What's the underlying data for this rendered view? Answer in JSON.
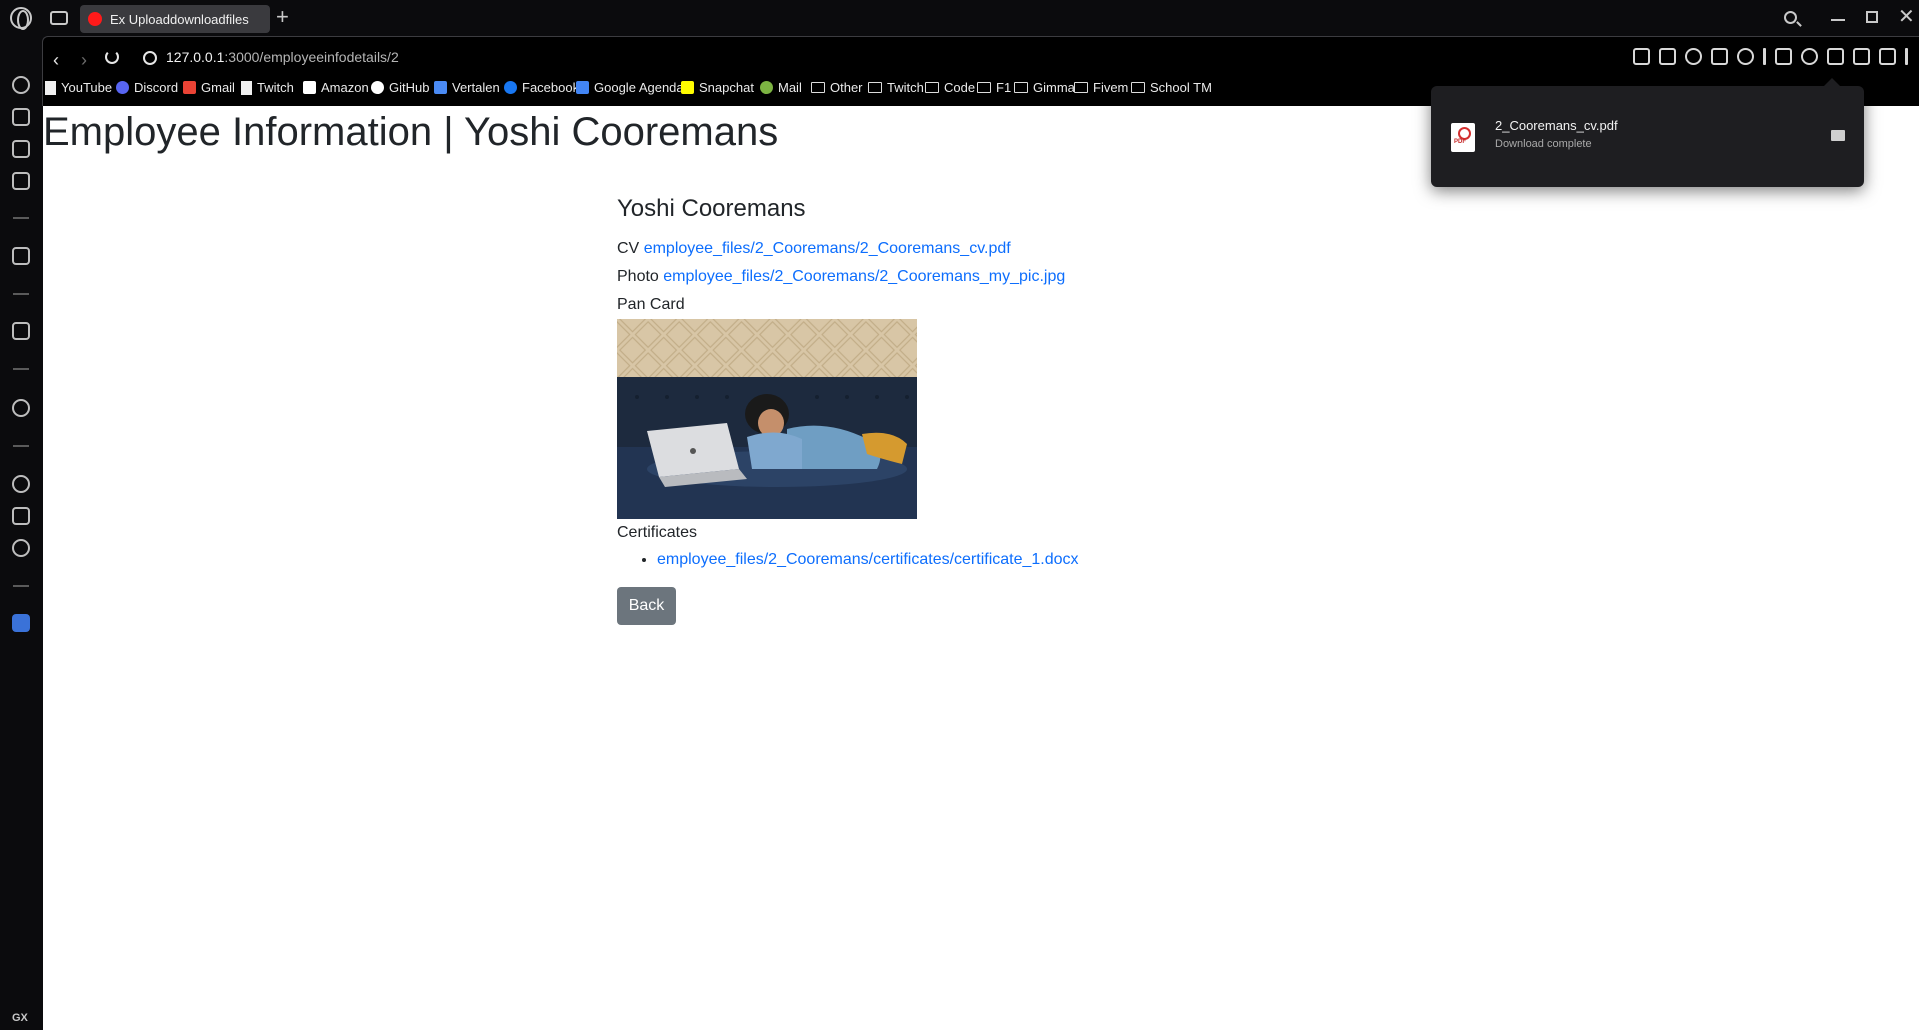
{
  "browser": {
    "tab_title": "Ex Uploaddownloadfiles",
    "new_tab": "+",
    "url_host": "127.0.0.1",
    "url_path": ":3000/employeeinfodetails/2",
    "sidebar_bottom_label": "GX",
    "sidebar_more": "…",
    "bookmarks": [
      {
        "label": "YouTube",
        "icon": "page-icon"
      },
      {
        "label": "Discord",
        "icon": "discord-icon",
        "color": "#5865f2"
      },
      {
        "label": "Gmail",
        "icon": "gmail-icon",
        "color": "#ea4335"
      },
      {
        "label": "Twitch",
        "icon": "page-icon"
      },
      {
        "label": "Amazon",
        "icon": "amazon-icon",
        "color": "#ffffff"
      },
      {
        "label": "GitHub",
        "icon": "github-icon",
        "color": "#ffffff"
      },
      {
        "label": "Vertalen",
        "icon": "translate-icon",
        "color": "#4a8af4"
      },
      {
        "label": "Facebook",
        "icon": "facebook-icon",
        "color": "#1877f2"
      },
      {
        "label": "Google Agenda",
        "icon": "calendar-icon",
        "color": "#4285f4"
      },
      {
        "label": "Snapchat",
        "icon": "snapchat-icon",
        "color": "#fffc00"
      },
      {
        "label": "Mail",
        "icon": "mail-icon",
        "color": "#7cb342"
      },
      {
        "label": "Other",
        "icon": "folder-icon"
      },
      {
        "label": "Twitch",
        "icon": "folder-icon"
      },
      {
        "label": "Code",
        "icon": "folder-icon"
      },
      {
        "label": "F1",
        "icon": "folder-icon"
      },
      {
        "label": "Gimma",
        "icon": "folder-icon"
      },
      {
        "label": "Fivem",
        "icon": "folder-icon"
      },
      {
        "label": "School TM",
        "icon": "folder-icon"
      }
    ]
  },
  "page": {
    "title": "Employee Information | Yoshi Cooremans",
    "employee_name": "Yoshi Cooremans",
    "cv_label": "CV",
    "cv_link": "employee_files/2_Cooremans/2_Cooremans_cv.pdf",
    "photo_label": "Photo",
    "photo_link": "employee_files/2_Cooremans/2_Cooremans_my_pic.jpg",
    "pan_card_label": "Pan Card",
    "certificates_label": "Certificates",
    "certificates": [
      "employee_files/2_Cooremans/certificates/certificate_1.docx"
    ],
    "back_button": "Back"
  },
  "download_popup": {
    "file_name": "2_Cooremans_cv.pdf",
    "status": "Download complete"
  },
  "colors": {
    "link": "#0d6efd",
    "back_button": "#6c757d",
    "tab_favicon": "#ff1a1a",
    "load_bar": "#2d7ae0"
  }
}
